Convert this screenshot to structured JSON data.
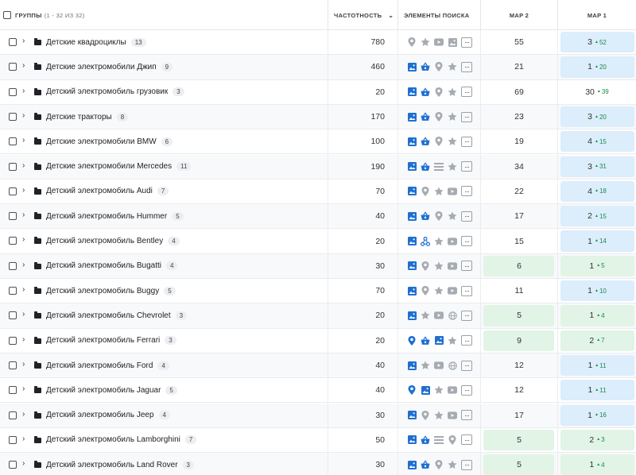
{
  "header": {
    "groups_label": "ГРУППЫ",
    "groups_count": "(1 - 32 ИЗ 32)",
    "frequency_label": "ЧАСТОТНОСТЬ",
    "features_label": "ЭЛЕМЕНТЫ ПОИСКА",
    "map2_label": "MAP 2",
    "map1_label": "MAP 1",
    "sort_icon": "chevron-down-icon"
  },
  "colors": {
    "icon_active": "#1f6fd1",
    "icon_inactive": "#a6abb2",
    "pill_blue": "#dcedfb",
    "pill_green": "#e1f4e6",
    "delta_green": "#1b8a4a"
  },
  "rows": [
    {
      "name": "Детские квадроциклы",
      "count": "13",
      "frequency": "780",
      "features": [
        [
          "pin",
          "gray"
        ],
        [
          "star",
          "gray"
        ],
        [
          "video",
          "gray"
        ],
        [
          "image",
          "gray"
        ]
      ],
      "map2": "55",
      "map2_bg": "",
      "map1": "3",
      "map1_delta": "52",
      "map1_bg": "blue"
    },
    {
      "name": "Детские электромобили Джип",
      "count": "9",
      "frequency": "460",
      "features": [
        [
          "image",
          "blue"
        ],
        [
          "basket",
          "blue"
        ],
        [
          "pin",
          "gray"
        ],
        [
          "star",
          "gray"
        ]
      ],
      "map2": "21",
      "map2_bg": "",
      "map1": "1",
      "map1_delta": "20",
      "map1_bg": "blue"
    },
    {
      "name": "Детский электромобиль грузовик",
      "count": "3",
      "frequency": "20",
      "features": [
        [
          "image",
          "blue"
        ],
        [
          "basket",
          "blue"
        ],
        [
          "pin",
          "gray"
        ],
        [
          "star",
          "gray"
        ]
      ],
      "map2": "69",
      "map2_bg": "",
      "map1": "30",
      "map1_delta": "39",
      "map1_bg": ""
    },
    {
      "name": "Детские тракторы",
      "count": "8",
      "frequency": "170",
      "features": [
        [
          "image",
          "blue"
        ],
        [
          "basket",
          "blue"
        ],
        [
          "pin",
          "gray"
        ],
        [
          "star",
          "gray"
        ]
      ],
      "map2": "23",
      "map2_bg": "",
      "map1": "3",
      "map1_delta": "20",
      "map1_bg": "blue"
    },
    {
      "name": "Детские электромобили BMW",
      "count": "6",
      "frequency": "100",
      "features": [
        [
          "image",
          "blue"
        ],
        [
          "basket",
          "blue"
        ],
        [
          "pin",
          "gray"
        ],
        [
          "star",
          "gray"
        ]
      ],
      "map2": "19",
      "map2_bg": "",
      "map1": "4",
      "map1_delta": "15",
      "map1_bg": "blue"
    },
    {
      "name": "Детские электромобили Mercedes",
      "count": "11",
      "frequency": "190",
      "features": [
        [
          "image",
          "blue"
        ],
        [
          "basket",
          "blue"
        ],
        [
          "list",
          "gray"
        ],
        [
          "star",
          "gray"
        ]
      ],
      "map2": "34",
      "map2_bg": "",
      "map1": "3",
      "map1_delta": "31",
      "map1_bg": "blue"
    },
    {
      "name": "Детский электромобиль Audi",
      "count": "7",
      "frequency": "70",
      "features": [
        [
          "image",
          "blue"
        ],
        [
          "pin",
          "gray"
        ],
        [
          "star",
          "gray"
        ],
        [
          "video",
          "gray"
        ]
      ],
      "map2": "22",
      "map2_bg": "",
      "map1": "4",
      "map1_delta": "18",
      "map1_bg": "blue"
    },
    {
      "name": "Детский электромобиль Hummer",
      "count": "5",
      "frequency": "40",
      "features": [
        [
          "image",
          "blue"
        ],
        [
          "basket",
          "blue"
        ],
        [
          "pin",
          "gray"
        ],
        [
          "star",
          "gray"
        ]
      ],
      "map2": "17",
      "map2_bg": "",
      "map1": "2",
      "map1_delta": "15",
      "map1_bg": "blue"
    },
    {
      "name": "Детский электромобиль Bentley",
      "count": "4",
      "frequency": "20",
      "features": [
        [
          "image",
          "blue"
        ],
        [
          "nodes",
          "blue"
        ],
        [
          "star",
          "gray"
        ],
        [
          "video",
          "gray"
        ]
      ],
      "map2": "15",
      "map2_bg": "",
      "map1": "1",
      "map1_delta": "14",
      "map1_bg": "blue"
    },
    {
      "name": "Детский электромобиль Bugatti",
      "count": "4",
      "frequency": "30",
      "features": [
        [
          "image",
          "blue"
        ],
        [
          "pin",
          "gray"
        ],
        [
          "star",
          "gray"
        ],
        [
          "video",
          "gray"
        ]
      ],
      "map2": "6",
      "map2_bg": "green",
      "map1": "1",
      "map1_delta": "5",
      "map1_bg": "green"
    },
    {
      "name": "Детский электромобиль Buggy",
      "count": "5",
      "frequency": "70",
      "features": [
        [
          "image",
          "blue"
        ],
        [
          "pin",
          "gray"
        ],
        [
          "star",
          "gray"
        ],
        [
          "video",
          "gray"
        ]
      ],
      "map2": "11",
      "map2_bg": "",
      "map1": "1",
      "map1_delta": "10",
      "map1_bg": "blue"
    },
    {
      "name": "Детский электромобиль Chevrolet",
      "count": "3",
      "frequency": "20",
      "features": [
        [
          "image",
          "blue"
        ],
        [
          "star",
          "gray"
        ],
        [
          "video",
          "gray"
        ],
        [
          "globe",
          "gray"
        ]
      ],
      "map2": "5",
      "map2_bg": "green",
      "map1": "1",
      "map1_delta": "4",
      "map1_bg": "green"
    },
    {
      "name": "Детский электромобиль Ferrari",
      "count": "3",
      "frequency": "20",
      "features": [
        [
          "pin",
          "blue"
        ],
        [
          "basket",
          "blue"
        ],
        [
          "image",
          "blue"
        ],
        [
          "star",
          "gray"
        ]
      ],
      "map2": "9",
      "map2_bg": "green",
      "map1": "2",
      "map1_delta": "7",
      "map1_bg": "green"
    },
    {
      "name": "Детский электромобиль Ford",
      "count": "4",
      "frequency": "40",
      "features": [
        [
          "image",
          "blue"
        ],
        [
          "star",
          "gray"
        ],
        [
          "video",
          "gray"
        ],
        [
          "globe",
          "gray"
        ]
      ],
      "map2": "12",
      "map2_bg": "",
      "map1": "1",
      "map1_delta": "11",
      "map1_bg": "blue"
    },
    {
      "name": "Детский электромобиль Jaguar",
      "count": "5",
      "frequency": "40",
      "features": [
        [
          "pin",
          "blue"
        ],
        [
          "image",
          "blue"
        ],
        [
          "star",
          "gray"
        ],
        [
          "video",
          "gray"
        ]
      ],
      "map2": "12",
      "map2_bg": "",
      "map1": "1",
      "map1_delta": "11",
      "map1_bg": "blue"
    },
    {
      "name": "Детский электромобиль Jeep",
      "count": "4",
      "frequency": "30",
      "features": [
        [
          "image",
          "blue"
        ],
        [
          "pin",
          "gray"
        ],
        [
          "star",
          "gray"
        ],
        [
          "video",
          "gray"
        ]
      ],
      "map2": "17",
      "map2_bg": "",
      "map1": "1",
      "map1_delta": "16",
      "map1_bg": "blue"
    },
    {
      "name": "Детский электромобиль Lamborghini",
      "count": "7",
      "frequency": "50",
      "features": [
        [
          "image",
          "blue"
        ],
        [
          "basket",
          "blue"
        ],
        [
          "list",
          "gray"
        ],
        [
          "pin",
          "gray"
        ]
      ],
      "map2": "5",
      "map2_bg": "green",
      "map1": "2",
      "map1_delta": "3",
      "map1_bg": "green"
    },
    {
      "name": "Детский электромобиль Land Rover",
      "count": "3",
      "frequency": "30",
      "features": [
        [
          "image",
          "blue"
        ],
        [
          "basket",
          "blue"
        ],
        [
          "pin",
          "gray"
        ],
        [
          "star",
          "gray"
        ]
      ],
      "map2": "5",
      "map2_bg": "green",
      "map1": "1",
      "map1_delta": "4",
      "map1_bg": "green"
    }
  ]
}
